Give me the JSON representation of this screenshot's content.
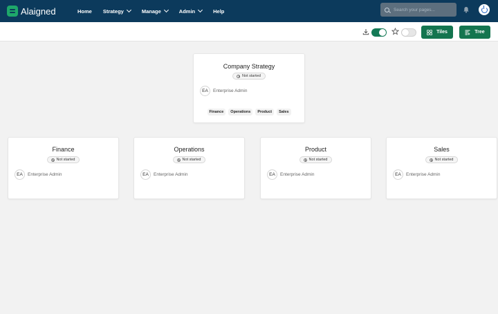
{
  "app": {
    "brand": "Alaigned"
  },
  "nav": {
    "items": [
      {
        "label": "Home",
        "has_menu": false
      },
      {
        "label": "Strategy",
        "has_menu": true
      },
      {
        "label": "Manage",
        "has_menu": true
      },
      {
        "label": "Admin",
        "has_menu": true
      },
      {
        "label": "Help",
        "has_menu": false
      }
    ]
  },
  "search": {
    "placeholder": "Search your pages..."
  },
  "toolbar": {
    "download_toggle_on": true,
    "favorite_toggle_on": false,
    "tiles_label": "Tiles",
    "tree_label": "Tree"
  },
  "tree": {
    "root": {
      "title": "Company Strategy",
      "status": "Not started",
      "owner_initials": "EA",
      "owner_name": "Enterprise Admin",
      "children_tags": [
        "Finance",
        "Operations",
        "Product",
        "Sales"
      ]
    },
    "children": [
      {
        "title": "Finance",
        "status": "Not started",
        "owner_initials": "EA",
        "owner_name": "Enterprise Admin"
      },
      {
        "title": "Operations",
        "status": "Not started",
        "owner_initials": "EA",
        "owner_name": "Enterprise Admin"
      },
      {
        "title": "Product",
        "status": "Not started",
        "owner_initials": "EA",
        "owner_name": "Enterprise Admin"
      },
      {
        "title": "Sales",
        "status": "Not started",
        "owner_initials": "EA",
        "owner_name": "Enterprise Admin"
      }
    ]
  },
  "colors": {
    "nav_bg": "#0c3a5c",
    "accent_green": "#14754f",
    "brand_green": "#1ea86a"
  }
}
